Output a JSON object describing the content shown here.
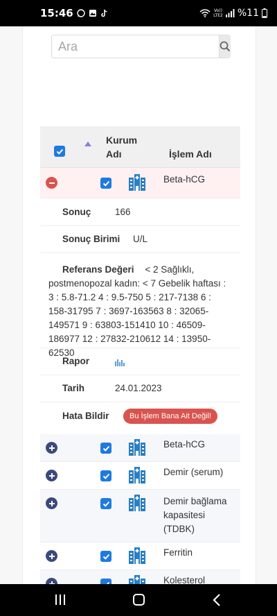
{
  "status_bar": {
    "time": "15:46",
    "carrier": "Vo))\nLTE2",
    "battery": "%11"
  },
  "search": {
    "placeholder": "Ara"
  },
  "table": {
    "header": {
      "kurum_line1": "Kurum",
      "kurum_line2": "Adı",
      "islem": "İşlem Adı"
    },
    "expanded": {
      "name": "Beta-hCG",
      "sonuc_label": "Sonuç",
      "sonuc_value": "166",
      "birim_label": "Sonuç Birimi",
      "birim_value": "U/L",
      "ref_label": "Referans Değeri",
      "ref_value": "< 2 Sağlıklı, postmenopozal kadın: < 7 Gebelik haftası : 3 : 5.8-71.2 4 : 9.5-750 5 : 217-7138 6 : 158-31795 7 : 3697-163563 8 : 32065-149571 9 : 63803-151410 10 : 46509-186977 12 : 27832-210612 14 : 13950-62530",
      "rapor_label": "Rapor",
      "tarih_label": "Tarih",
      "tarih_value": "24.01.2023",
      "hata_label": "Hata Bildir",
      "hata_button": "Bu İşlem Bana Ait Değil!"
    },
    "rows": [
      {
        "line1": "Beta-hCG",
        "line2": "",
        "line3": ""
      },
      {
        "line1": "Demir (serum)",
        "line2": "",
        "line3": ""
      },
      {
        "line1": "Demir bağlama",
        "line2": "kapasitesi",
        "line3": "(TDBK)"
      },
      {
        "line1": "Ferritin",
        "line2": "",
        "line3": ""
      },
      {
        "line1": "Kolesterol",
        "line2": "",
        "line3": ""
      }
    ]
  }
}
